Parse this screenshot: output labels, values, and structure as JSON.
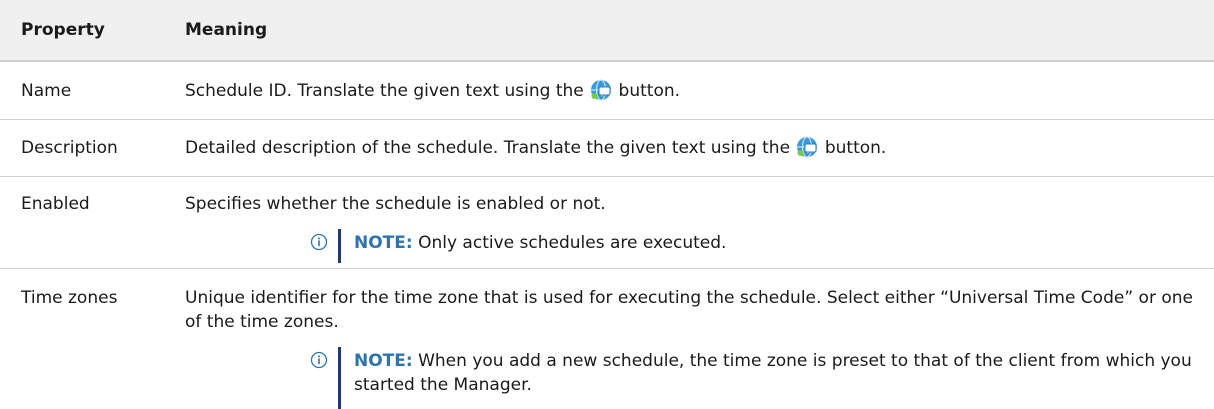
{
  "header": {
    "property": "Property",
    "meaning": "Meaning"
  },
  "rows": [
    {
      "property": "Name",
      "meaning_before": "Schedule ID. Translate the given text using the",
      "meaning_after": "button.",
      "icon": "translate-icon"
    },
    {
      "property": "Description",
      "meaning_before": "Detailed description of the schedule. Translate the given text using the",
      "meaning_after": "button.",
      "icon": "translate-icon"
    },
    {
      "property": "Enabled",
      "meaning": "Specifies whether the schedule is enabled or not.",
      "note_label": "NOTE:",
      "note_text": "Only active schedules are executed.",
      "note_icon": "info-icon"
    },
    {
      "property": "Time zones",
      "meaning": "Unique identifier for the time zone that is used for executing the schedule. Select either “Universal Time Code” or one of the time zones.",
      "note_label": "NOTE:",
      "note_text": "When you add a new schedule, the time zone is preset to that of the client from which you started the Manager.",
      "note_icon": "info-icon"
    }
  ],
  "colors": {
    "header_bg": "#f0f0f0",
    "note_label": "#2e73ad",
    "note_bar": "#1f3a6e",
    "row_divider": "#cfcfcf"
  }
}
